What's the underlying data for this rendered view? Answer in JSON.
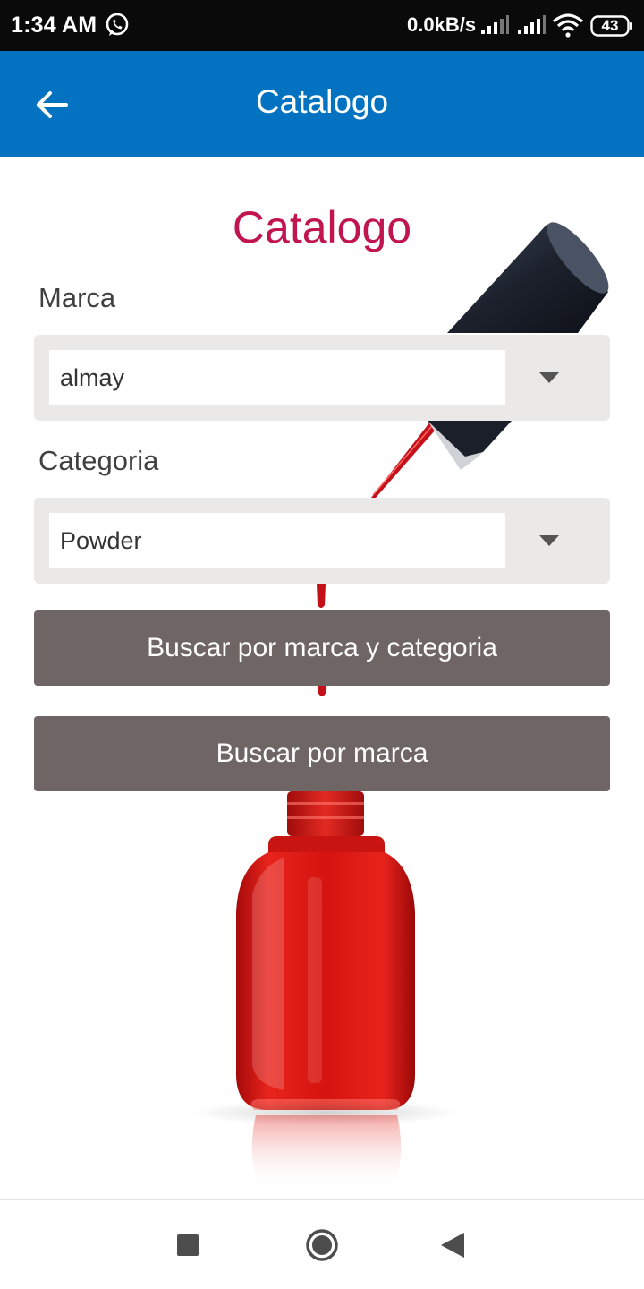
{
  "status_bar": {
    "time": "1:34 AM",
    "net_speed": "0.0kB/s",
    "battery": "43",
    "icons": [
      "whatsapp-icon",
      "signal-icon",
      "signal-icon",
      "wifi-icon",
      "battery-icon"
    ]
  },
  "app_bar": {
    "title": "Catalogo",
    "back_icon": "arrow-left-icon",
    "color": "#0272c1"
  },
  "form": {
    "heading": "Catalogo",
    "heading_color": "#c0154f",
    "marca_label": "Marca",
    "marca_value": "almay",
    "categoria_label": "Categoria",
    "categoria_value": "Powder",
    "dropdown_icon": "caret-down-icon"
  },
  "buttons": {
    "search_both": "Buscar por marca y categoria",
    "search_marca": "Buscar por marca",
    "color": "#706565"
  },
  "nav_bar": {
    "icons": [
      "square-recents-icon",
      "circle-home-icon",
      "triangle-back-icon"
    ]
  }
}
